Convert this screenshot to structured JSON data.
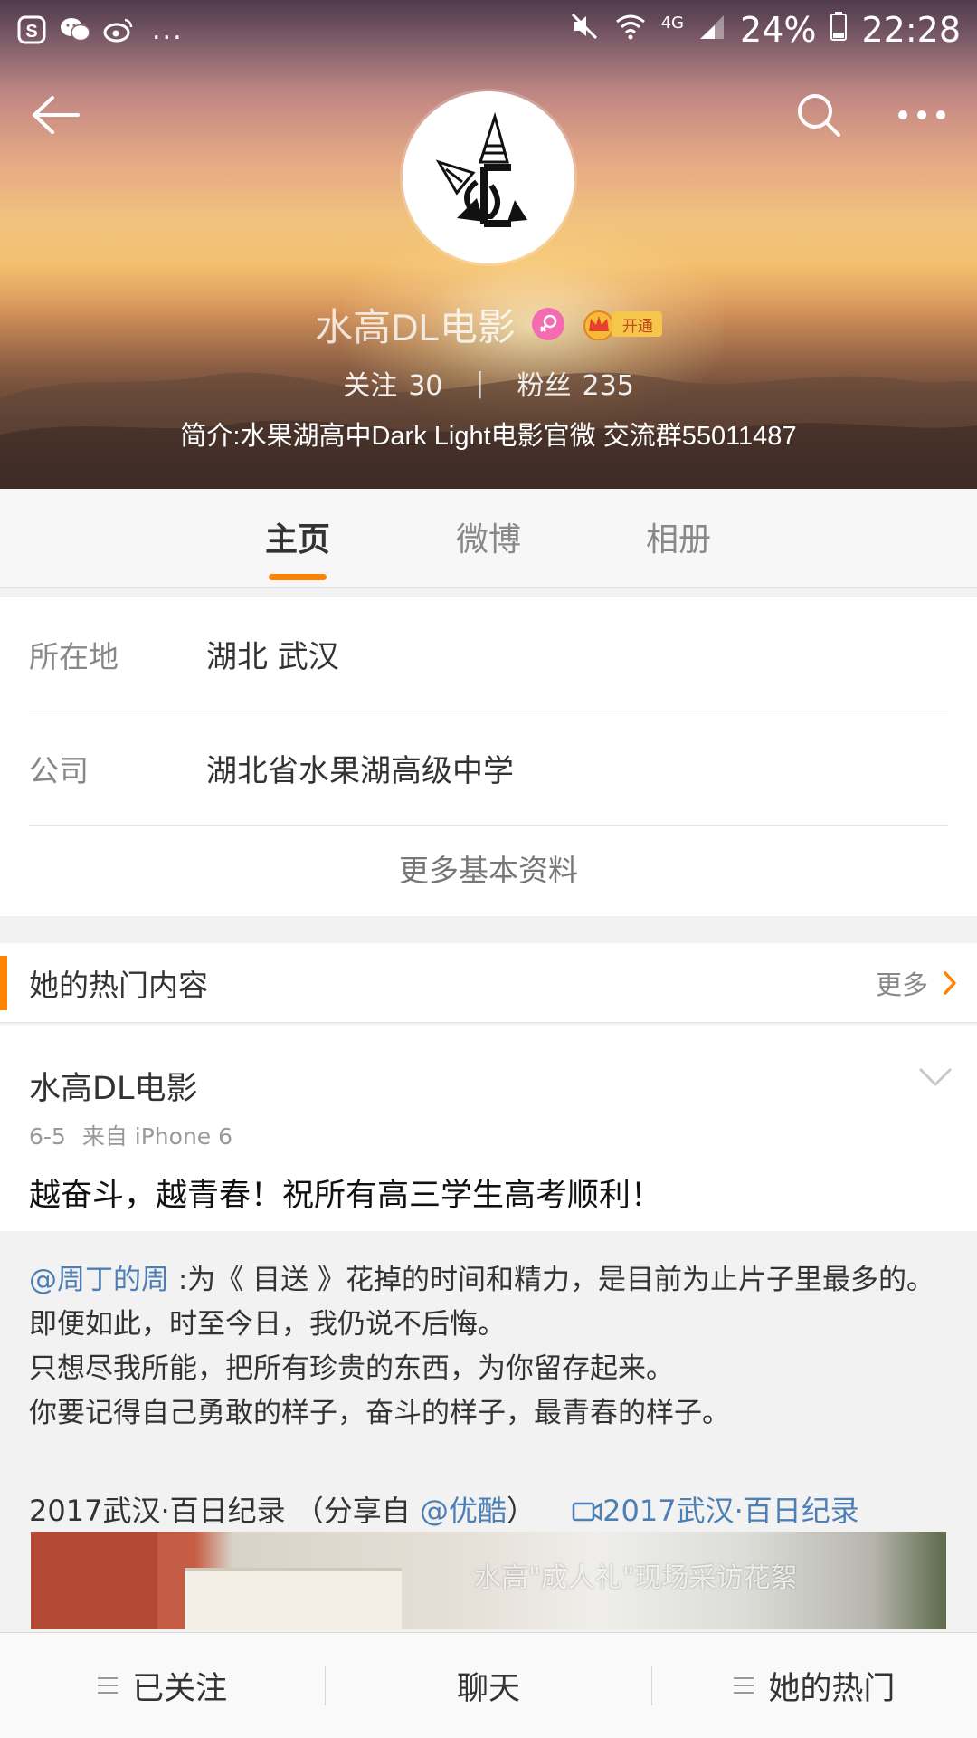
{
  "statusbar": {
    "left_icons": [
      "sogou-icon",
      "wechat-icon",
      "weibo-icon"
    ],
    "more_indicator": "...",
    "network": "4G",
    "battery_pct": "24%",
    "time": "22:28"
  },
  "profile": {
    "name": "水高DL电影",
    "gender": "female",
    "vip_label": "开通",
    "following_label": "关注",
    "following_count": "30",
    "followers_label": "粉丝",
    "followers_count": "235",
    "intro": "简介:水果湖高中Dark Light电影官微 交流群55011487"
  },
  "tabs": [
    {
      "label": "主页",
      "active": true
    },
    {
      "label": "微博",
      "active": false
    },
    {
      "label": "相册",
      "active": false
    }
  ],
  "info": {
    "location_label": "所在地",
    "location_value": "湖北 武汉",
    "company_label": "公司",
    "company_value": "湖北省水果湖高级中学",
    "more_label": "更多基本资料"
  },
  "hot": {
    "title": "她的热门内容",
    "more_label": "更多"
  },
  "post": {
    "author": "水高DL电影",
    "date": "6-5",
    "source": "来自 iPhone 6",
    "text": "越奋斗，越青春！祝所有高三学生高考顺利！",
    "repost": {
      "mention": "@周丁的周",
      "line1": " :为《 目送 》花掉的时间和精力，是目前为止片子里最多的。",
      "line2": "即便如此，时至今日，我仍说不后悔。",
      "line3": "只想尽我所能，把所有珍贵的东西，为你留存起来。",
      "line4": "你要记得自己勇敢的样子，奋斗的样子，最青春的样子。",
      "source_prefix": "2017武汉·百日纪录 （分享自 ",
      "source_mention": "@优酷",
      "source_suffix": "）",
      "video_link": "2017武汉·百日纪录",
      "thumb_caption": "水高\"成人礼\"现场采访花絮"
    }
  },
  "bottom_bar": {
    "follow_label": "已关注",
    "chat_label": "聊天",
    "hot_label": "她的热门"
  },
  "colors": {
    "accent": "#ff8200",
    "link": "#4d7fb5",
    "female_badge": "#f46bb0",
    "vip_gold": "#f6c64c"
  }
}
